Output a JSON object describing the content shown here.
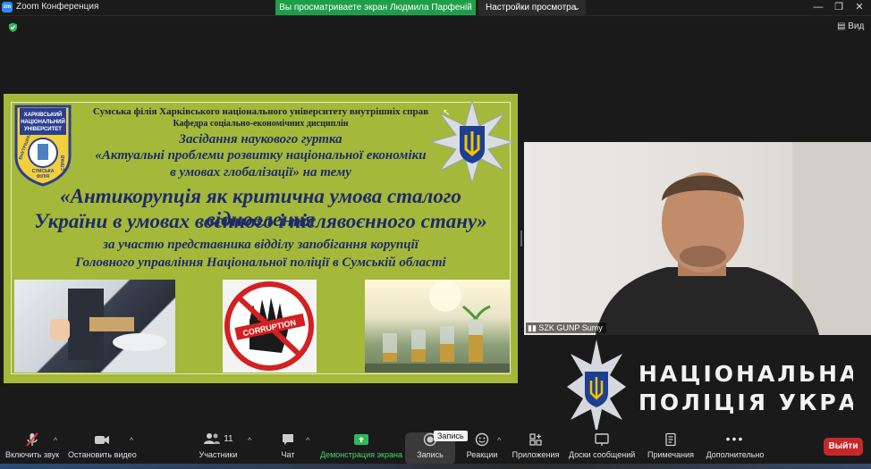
{
  "window": {
    "app_icon_text": "zm",
    "title": "Zoom Конференция",
    "minimize": "—",
    "restore": "❐",
    "close": "✕"
  },
  "share_banner": {
    "text": "Вы просматриваете экран Людмила Парфенiй",
    "view_settings_label": "Настройки просмотра",
    "view_settings_chevron": "⌄"
  },
  "top_right": {
    "view_label": "Вид"
  },
  "slide": {
    "line1": "Сумська філія Харківського національного університету внутрішніх справ",
    "line2": "Кафедра соціально-економічних дисциплін",
    "line3": "Засідання наукового гуртка",
    "line4": "«Актуальні проблеми розвитку національної економіки",
    "line5": "в умовах глобалізації» на тему",
    "line6": "«Антикорупція як критична умова сталого відновлення",
    "line7": "України в умовах воєнного і післявоєнного стану»",
    "line8": "за участю представника відділу запобігання корупції",
    "line9": "Головного управління Національної поліції в Сумській області",
    "badge_lines": [
      "ХАРКІВСЬКИЙ",
      "НАЦІОНАЛЬНИЙ",
      "УНІВЕРСИТЕТ",
      "ВНУТРІШНІХ",
      "СПРАВ",
      "СУМСЬКА",
      "ФІЛІЯ"
    ],
    "corruption_label": "CORRUPTION",
    "background_color": "#a4b83a"
  },
  "participant": {
    "name": "SZK GUNP Sumy"
  },
  "watermark": {
    "line1": "НАЦІОНАЛЬНА",
    "line2": "ПОЛІЦІЯ УКРАЇНИ"
  },
  "toolbar": {
    "mute_label": "Включить звук",
    "video_label": "Остановить видео",
    "participants_label": "Участники",
    "participants_count": "11",
    "chat_label": "Чат",
    "share_label": "Демонстрация экрана",
    "record_label": "Запись",
    "record_tooltip": "Запись",
    "reactions_label": "Реакции",
    "apps_label": "Приложения",
    "whiteboards_label": "Доски сообщений",
    "notes_label": "Примечания",
    "more_label": "Дополнительно",
    "exit_label": "Выйти",
    "caret": "^"
  },
  "colors": {
    "accent_green": "#1f9e4a",
    "exit_red": "#c62828",
    "zoom_blue": "#2d8cff"
  }
}
